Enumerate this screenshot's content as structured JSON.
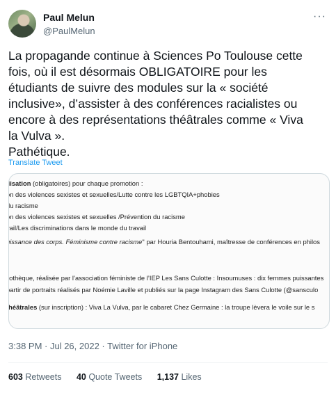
{
  "author": {
    "name": "Paul Melun",
    "handle": "@PaulMelun"
  },
  "tweet": {
    "text": "La propagande continue à Sciences Po Toulouse cette\nfois, où il est désormais OBLIGATOIRE pour les\nétudiants de suivre des modules sur la « société\ninclusive», d’assister à des conférences racialistes ou\nencore à des représentations théâtrales comme « Viva\nla Vulva ».\nPathétique.",
    "translate_label": "Translate Tweet",
    "timestamp": "3:38 PM · Jul 26, 2022 · Twitter for iPhone"
  },
  "document_image": {
    "line1_bold": "ilisation",
    "line1_rest": " (obligatoires) pour chaque promotion :",
    "line2": "on des violences sexistes et sexuelles/Lutte contre les LGBTQIA+phobies",
    "line3": " du racisme",
    "line4": "on des violences sexistes et sexuelles /Prévention du racisme",
    "line5": "vail/Les discriminations dans le monde du travail",
    "line6_italic": "uissance des corps. Féminisme contre racisme",
    "line6_rest": "\" par Houria Bentouhami, maîtresse de conférences en philos",
    "line7": "liothèque, réalisée par l’association féministe de l’IEP Les Sans Culotte : Insoumuses : dix femmes puissantes",
    "line8": "partir de portraits réalisés par Noémie Laville et publiés sur la page Instagram des Sans Culotte (@sansculo",
    "line9_bold": "théâtrales",
    "line9_rest": " (sur inscription) : Viva La Vulva, par le cabaret Chez Germaine : la troupe lèvera le voile sur le s"
  },
  "stats": {
    "retweets_count": "603",
    "retweets_label": "Retweets",
    "quotes_count": "40",
    "quotes_label": "Quote Tweets",
    "likes_count": "1,137",
    "likes_label": "Likes"
  },
  "icons": {
    "avatar": "profile-photo",
    "more": "more-icon"
  },
  "colors": {
    "link": "#1d9bf0",
    "secondary": "#536471",
    "text": "#0f1419"
  }
}
